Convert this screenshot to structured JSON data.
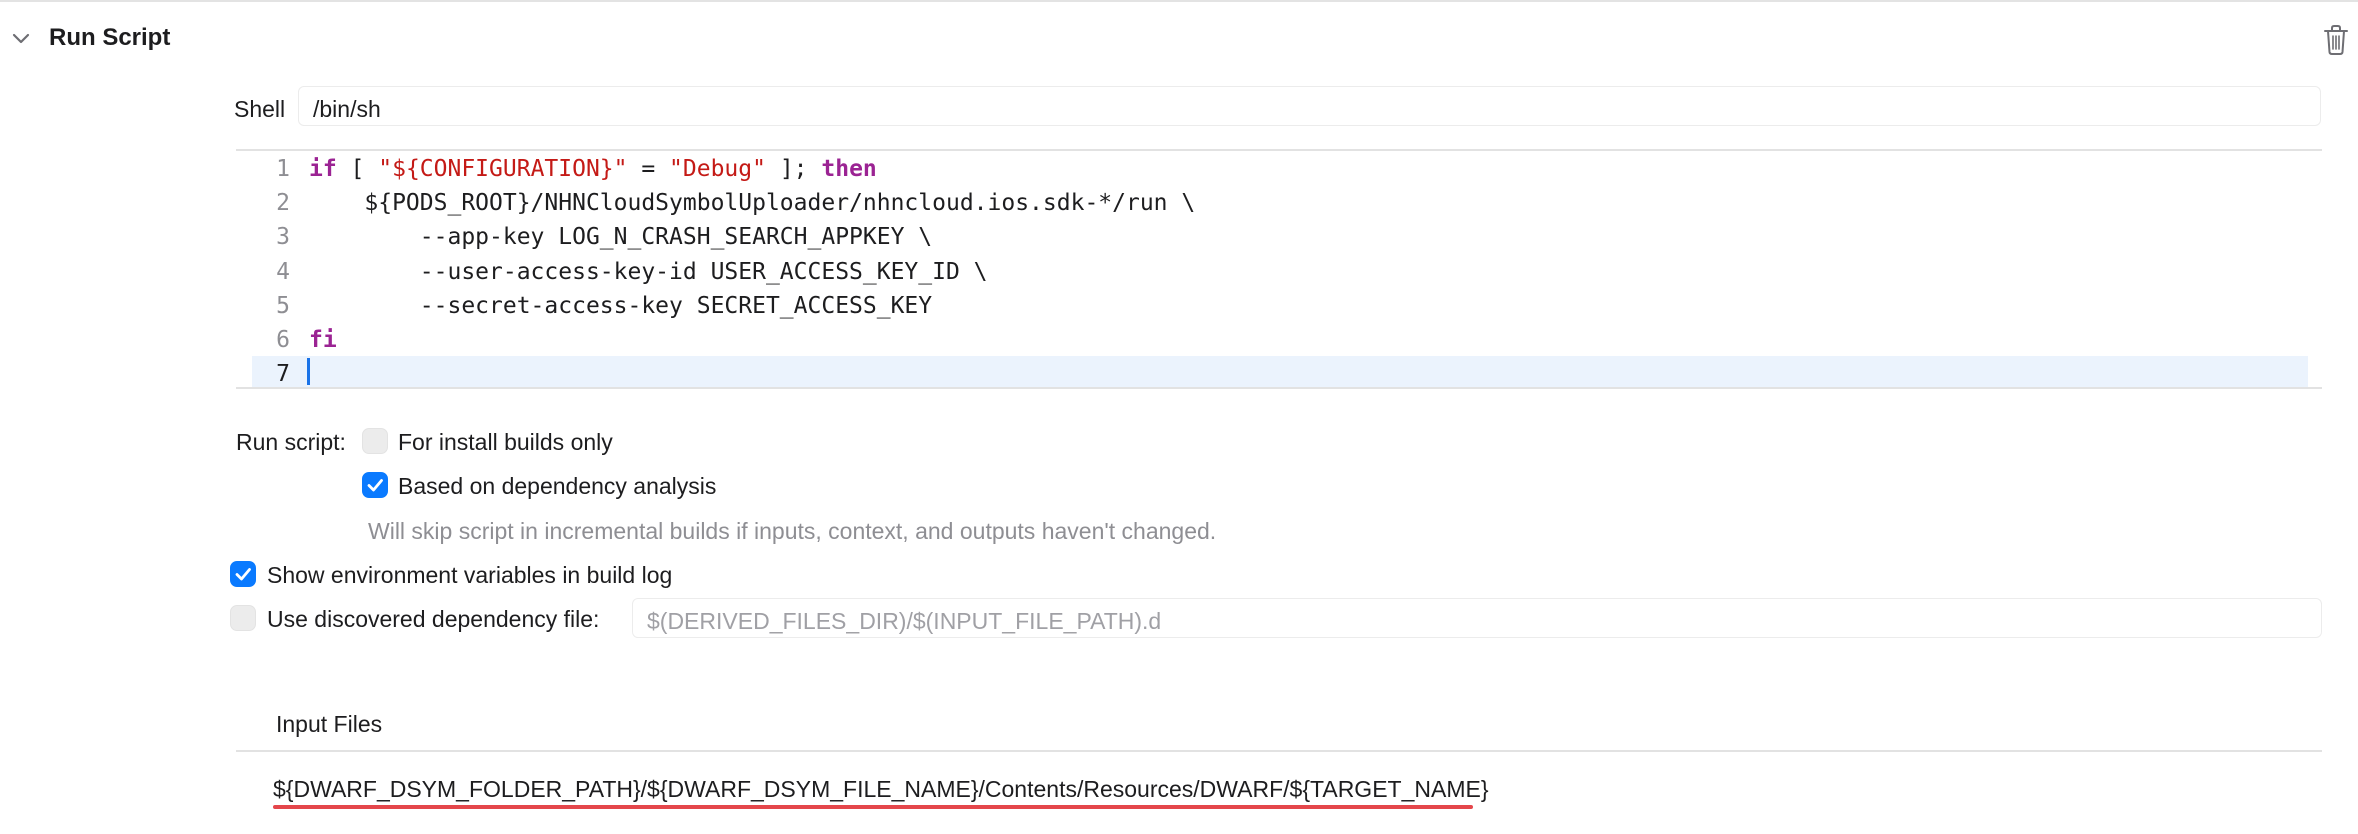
{
  "header": {
    "title": "Run Script",
    "collapse_icon": "chevron-down-icon",
    "delete_icon": "trash-icon"
  },
  "shell": {
    "label": "Shell",
    "value": "/bin/sh"
  },
  "script": {
    "lines": [
      {
        "n": "1",
        "segments": [
          {
            "t": "if",
            "c": "kw"
          },
          {
            "t": " [ ",
            "c": ""
          },
          {
            "t": "\"${CONFIGURATION}\"",
            "c": "str"
          },
          {
            "t": " = ",
            "c": ""
          },
          {
            "t": "\"Debug\"",
            "c": "str"
          },
          {
            "t": " ]; ",
            "c": ""
          },
          {
            "t": "then",
            "c": "kw"
          }
        ]
      },
      {
        "n": "2",
        "segments": [
          {
            "t": "    ${PODS_ROOT}/NHNCloudSymbolUploader/nhncloud.ios.sdk-*/run \\",
            "c": ""
          }
        ]
      },
      {
        "n": "3",
        "segments": [
          {
            "t": "        --app-key LOG_N_CRASH_SEARCH_APPKEY \\",
            "c": ""
          }
        ]
      },
      {
        "n": "4",
        "segments": [
          {
            "t": "        --user-access-key-id USER_ACCESS_KEY_ID \\",
            "c": ""
          }
        ]
      },
      {
        "n": "5",
        "segments": [
          {
            "t": "        --secret-access-key SECRET_ACCESS_KEY",
            "c": ""
          }
        ]
      },
      {
        "n": "6",
        "segments": [
          {
            "t": "fi",
            "c": "kw"
          }
        ]
      },
      {
        "n": "7",
        "segments": []
      }
    ],
    "current_line": "7"
  },
  "options": {
    "run_script_label": "Run script:",
    "install_builds_only": {
      "label": "For install builds only",
      "checked": false
    },
    "dependency_analysis": {
      "label": "Based on dependency analysis",
      "checked": true
    },
    "dependency_hint": "Will skip script in incremental builds if inputs, context, and outputs haven't changed.",
    "show_env_vars": {
      "label": "Show environment variables in build log",
      "checked": true
    },
    "discovered_dep_file": {
      "label": "Use discovered dependency file:",
      "checked": false,
      "placeholder": "$(DERIVED_FILES_DIR)/$(INPUT_FILE_PATH).d"
    }
  },
  "input_files": {
    "label": "Input Files",
    "items": [
      "${DWARF_DSYM_FOLDER_PATH}/${DWARF_DSYM_FILE_NAME}/Contents/Resources/DWARF/${TARGET_NAME}"
    ]
  },
  "colors": {
    "accent": "#0a7aff",
    "keyword": "#9b2393",
    "string": "#c41a16",
    "error_underline": "#e4464b"
  }
}
